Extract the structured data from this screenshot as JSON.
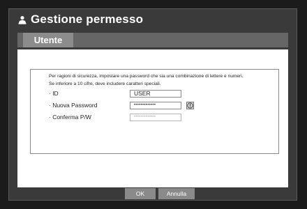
{
  "window": {
    "title": "Gestione permesso"
  },
  "tabs": [
    {
      "label": "Utente",
      "active": true
    }
  ],
  "notice": {
    "line1": "Per ragioni di sicurezza, impostare una password che sia una combinazione di lettere e numeri.",
    "line2": "Se inferiore a 10 cifre, deve includere caratteri speciali."
  },
  "form": {
    "id_label": "· ID",
    "id_value": "USER",
    "new_password_label": "· Nuova Password",
    "new_password_value": "•••••••••••••",
    "confirm_label": "· Conferma P/W",
    "confirm_value": "•••••••••••••"
  },
  "buttons": {
    "ok": "OK",
    "cancel": "Annulla"
  },
  "icons": {
    "title": "user-icon",
    "info": "info-icon"
  },
  "colors": {
    "background": "#1b1b1b",
    "window": "#3a3a3a",
    "tab_active": "#8c8c8c",
    "button": "#8a8a8a"
  }
}
